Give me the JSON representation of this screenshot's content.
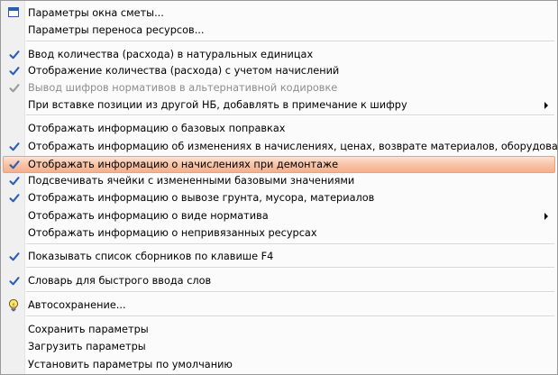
{
  "menu": {
    "items": [
      {
        "label": "Параметры окна сметы...",
        "checked": false,
        "disabled": false,
        "submenu": false,
        "icon": "window-icon"
      },
      {
        "label": "Параметры переноса ресурсов...",
        "checked": false,
        "disabled": false,
        "submenu": false
      },
      {
        "label": "Ввод количества (расхода) в натуральных единицах",
        "checked": true,
        "disabled": false,
        "submenu": false
      },
      {
        "label": "Отображение количества (расхода) с учетом начислений",
        "checked": true,
        "disabled": false,
        "submenu": false
      },
      {
        "label": "Вывод шифров нормативов в альтернативной кодировке",
        "checked": true,
        "disabled": true,
        "submenu": false
      },
      {
        "label": "При вставке позиции из другой НБ, добавлять в примечание к шифру",
        "checked": false,
        "disabled": false,
        "submenu": true
      },
      {
        "label": "Отображать информацию о базовых поправках",
        "checked": false,
        "disabled": false,
        "submenu": false
      },
      {
        "label": "Отображать информацию об изменениях в начислениях, ценах, возврате материалов, оборудовании",
        "checked": true,
        "disabled": false,
        "submenu": false
      },
      {
        "label": "Отображать информацию о начислениях при демонтаже",
        "checked": true,
        "disabled": false,
        "submenu": false,
        "highlighted": true
      },
      {
        "label": "Подсвечивать ячейки с измененными базовыми значениями",
        "checked": true,
        "disabled": false,
        "submenu": false
      },
      {
        "label": "Отображать информацию о вывозе грунта, мусора, материалов",
        "checked": true,
        "disabled": false,
        "submenu": false
      },
      {
        "label": "Отображать информацию о виде норматива",
        "checked": false,
        "disabled": false,
        "submenu": true
      },
      {
        "label": "Отображать информацию о непривязанных ресурсах",
        "checked": false,
        "disabled": false,
        "submenu": false
      },
      {
        "label": "Показывать список сборников по клавише F4",
        "checked": true,
        "disabled": false,
        "submenu": false
      },
      {
        "label": "Словарь для быстрого ввода слов",
        "checked": true,
        "disabled": false,
        "submenu": false
      },
      {
        "label": "Автосохранение...",
        "checked": false,
        "disabled": false,
        "submenu": false,
        "icon": "lightbulb-icon"
      },
      {
        "label": "Сохранить параметры",
        "checked": false,
        "disabled": false,
        "submenu": false
      },
      {
        "label": "Загрузить параметры",
        "checked": false,
        "disabled": false,
        "submenu": false
      },
      {
        "label": "Установить параметры по умолчанию",
        "checked": false,
        "disabled": false,
        "submenu": false
      }
    ]
  },
  "colors": {
    "check": "#2b5fb3",
    "check_disabled": "#9a9a9a",
    "highlight": "#f8c0a2"
  }
}
